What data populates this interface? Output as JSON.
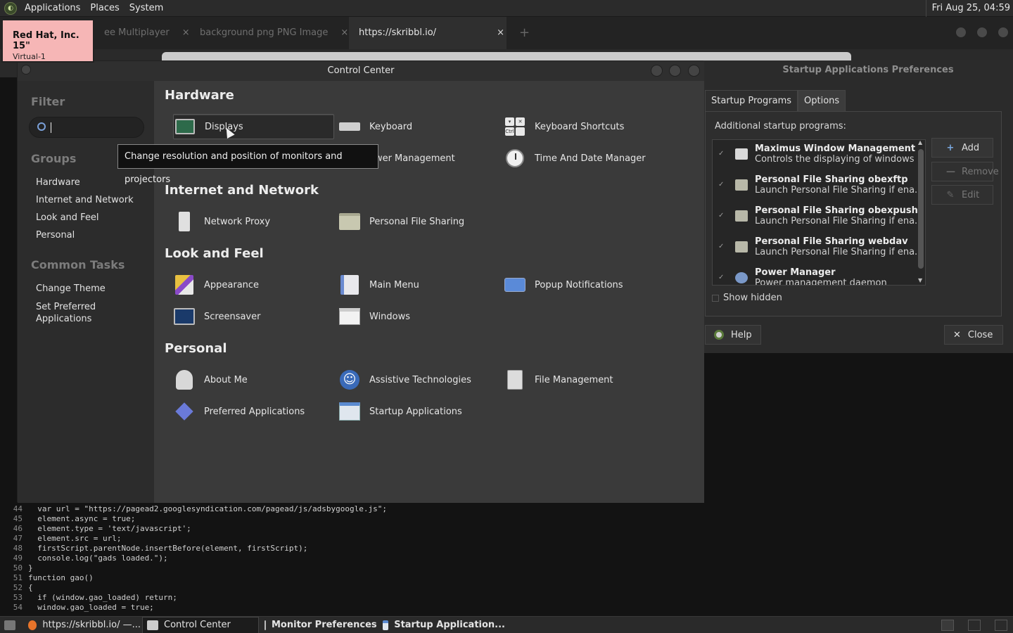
{
  "top_panel": {
    "menus": [
      "Applications",
      "Places",
      "System"
    ],
    "clock": "Fri Aug 25, 04:59"
  },
  "browser": {
    "tabs": [
      {
        "label": "ee Multiplayer"
      },
      {
        "label": "background png PNG Image"
      },
      {
        "label": "https://skribbl.io/",
        "active": true
      }
    ],
    "tab_close": "×",
    "new_tab": "+"
  },
  "display_osd": {
    "title": "Red Hat, Inc. 15\"",
    "subtitle": "Virtual-1"
  },
  "control_center": {
    "title": "Control Center",
    "filter_label": "Filter",
    "search_value": "",
    "groups_label": "Groups",
    "groups": [
      "Hardware",
      "Internet and Network",
      "Look and Feel",
      "Personal"
    ],
    "tasks_label": "Common Tasks",
    "tasks": [
      "Change Theme",
      "Set Preferred Applications"
    ],
    "sections": {
      "hardware": {
        "title": "Hardware",
        "items": [
          "Displays",
          "Keyboard",
          "Keyboard Shortcuts",
          "ower Management",
          "Time And Date Manager"
        ]
      },
      "internet": {
        "title": "Internet and Network",
        "items": [
          "Network Proxy",
          "Personal File Sharing"
        ]
      },
      "look": {
        "title": "Look and Feel",
        "items": [
          "Appearance",
          "Main Menu",
          "Popup Notifications",
          "Screensaver",
          "Windows"
        ]
      },
      "personal": {
        "title": "Personal",
        "items": [
          "About Me",
          "Assistive Technologies",
          "File Management",
          "Preferred Applications",
          "Startup Applications"
        ]
      }
    },
    "tooltip": "Change resolution and position of monitors and projectors"
  },
  "startup_prefs": {
    "title": "Startup Applications Preferences",
    "tabs": [
      "Startup Programs",
      "Options"
    ],
    "additional_label": "Additional startup programs:",
    "programs": [
      {
        "name": "Maximus Window Management",
        "desc": "Controls the displaying of windows",
        "checked": true
      },
      {
        "name": "Personal File Sharing obexftp",
        "desc": "Launch Personal File Sharing if ena...",
        "checked": true
      },
      {
        "name": "Personal File Sharing obexpush",
        "desc": "Launch Personal File Sharing if ena...",
        "checked": true
      },
      {
        "name": "Personal File Sharing webdav",
        "desc": "Launch Personal File Sharing if ena...",
        "checked": true
      },
      {
        "name": "Power Manager",
        "desc": "Power management daemon",
        "checked": true
      }
    ],
    "buttons": {
      "add": "Add",
      "remove": "Remove",
      "edit": "Edit"
    },
    "show_hidden": "Show hidden",
    "help": "Help",
    "close": "Close"
  },
  "code": {
    "lines": [
      {
        "n": "44",
        "t": "  var url = \"https://pagead2.googlesyndication.com/pagead/js/adsbygoogle.js\";"
      },
      {
        "n": "45",
        "t": "  element.async = true;"
      },
      {
        "n": "46",
        "t": "  element.type = 'text/javascript';"
      },
      {
        "n": "47",
        "t": "  element.src = url;"
      },
      {
        "n": "48",
        "t": "  firstScript.parentNode.insertBefore(element, firstScript);"
      },
      {
        "n": "49",
        "t": "  console.log(\"gads loaded.\");"
      },
      {
        "n": "50",
        "t": "}"
      },
      {
        "n": "51",
        "t": "function gao()"
      },
      {
        "n": "52",
        "t": "{"
      },
      {
        "n": "53",
        "t": "  if (window.gao_loaded) return;"
      },
      {
        "n": "54",
        "t": "  window.gao_loaded = true;"
      }
    ]
  },
  "taskbar": {
    "tasks": [
      {
        "label": "https://skribbl.io/ —...",
        "bold": false,
        "active": false
      },
      {
        "label": "Control Center",
        "bold": false,
        "active": true
      },
      {
        "label": "Monitor Preferences",
        "bold": true,
        "active": false
      },
      {
        "label": "Startup Application...",
        "bold": true,
        "active": false
      }
    ]
  }
}
